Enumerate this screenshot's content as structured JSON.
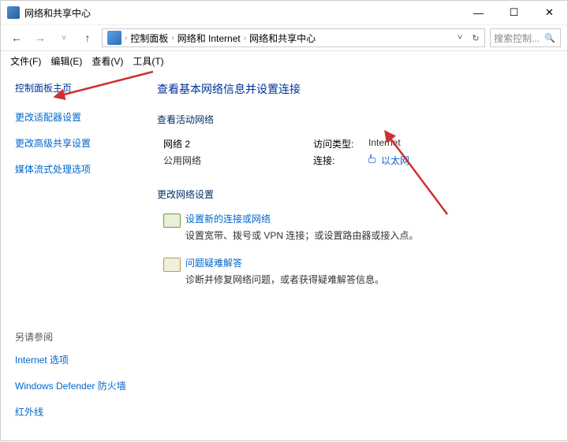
{
  "titlebar": {
    "title": "网络和共享中心"
  },
  "breadcrumb": {
    "root": "控制面板",
    "mid": "网络和 Internet",
    "leaf": "网络和共享中心"
  },
  "search": {
    "placeholder": "搜索控制..."
  },
  "menu": {
    "file": "文件(F)",
    "edit": "编辑(E)",
    "view": "查看(V)",
    "tools": "工具(T)"
  },
  "sidebar": {
    "home": "控制面板主页",
    "adapter": "更改适配器设置",
    "advanced": "更改高级共享设置",
    "media": "媒体流式处理选项",
    "seealso_h": "另请参阅",
    "seealso": {
      "internet": "Internet 选项",
      "defender": "Windows Defender 防火墙",
      "ir": "红外线"
    }
  },
  "main": {
    "heading": "查看基本网络信息并设置连接",
    "active_h": "查看活动网络",
    "network": {
      "name": "网络 2",
      "type": "公用网络",
      "access_lbl": "访问类型:",
      "access_val": "Internet",
      "conn_lbl": "连接:",
      "conn_val": "以太网"
    },
    "change_h": "更改网络设置",
    "opt1": {
      "title": "设置新的连接或网络",
      "desc": "设置宽带、拨号或 VPN 连接；或设置路由器或接入点。"
    },
    "opt2": {
      "title": "问题疑难解答",
      "desc": "诊断并修复网络问题，或者获得疑难解答信息。"
    }
  }
}
